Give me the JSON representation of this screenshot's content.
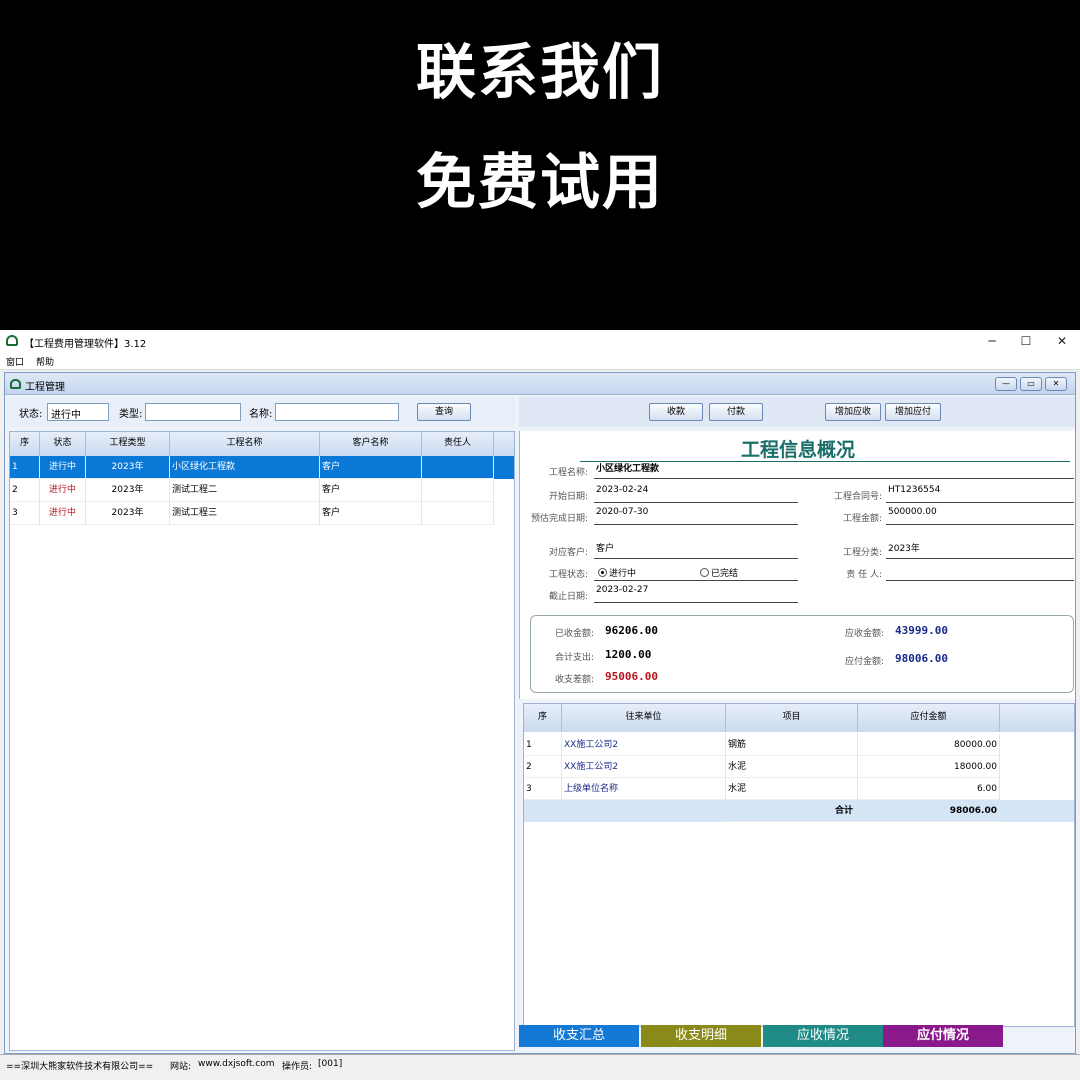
{
  "banner": {
    "line1": "联系我们",
    "line2": "免费试用"
  },
  "window": {
    "title": "【工程费用管理软件】3.12",
    "controls": {
      "minimize": "─",
      "maximize": "☐",
      "close": "✕"
    },
    "menu": [
      "窗口",
      "帮助"
    ]
  },
  "child": {
    "title": "工程管理",
    "controls": {
      "minimize": "—",
      "restore": "▭",
      "close": "✕"
    }
  },
  "filter": {
    "status_label": "状态:",
    "status_value": "进行中",
    "type_label": "类型:",
    "type_value": "",
    "name_label": "名称:",
    "name_value": "",
    "query_button": "查询"
  },
  "actions": {
    "receive": "收款",
    "pay": "付款",
    "add_receivable": "增加应收",
    "add_payable": "增加应付"
  },
  "project_table": {
    "columns": [
      "序",
      "状态",
      "工程类型",
      "工程名称",
      "客户名称",
      "责任人"
    ],
    "rows": [
      {
        "no": "1",
        "status": "进行中",
        "type": "2023年",
        "name": "小区绿化工程款",
        "client": "客户",
        "owner": ""
      },
      {
        "no": "2",
        "status": "进行中",
        "type": "2023年",
        "name": "测试工程二",
        "client": "客户",
        "owner": ""
      },
      {
        "no": "3",
        "status": "进行中",
        "type": "2023年",
        "name": "测试工程三",
        "client": "客户",
        "owner": ""
      }
    ]
  },
  "info": {
    "heading": "工程信息概况",
    "name_label": "工程名称:",
    "name": "小区绿化工程款",
    "start_label": "开始日期:",
    "start": "2023-02-24",
    "contract_label": "工程合同号:",
    "contract": "HT1236554",
    "expected_label": "预估完成日期:",
    "expected": "2020-07-30",
    "amount_label": "工程金额:",
    "amount": "500000.00",
    "client_label": "对应客户:",
    "client": "客户",
    "category_label": "工程分类:",
    "category": "2023年",
    "status_label": "工程状态:",
    "status_ongoing": "进行中",
    "status_done": "已完结",
    "owner_label": "责 任 人:",
    "owner": "",
    "deadline_label": "截止日期:",
    "deadline": "2023-02-27",
    "received_label": "已收金额:",
    "received": "96206.00",
    "receivable_label": "应收金额:",
    "receivable": "43999.00",
    "spent_label": "合计支出:",
    "spent": "1200.00",
    "payable_label": "应付金额:",
    "payable": "98006.00",
    "diff_label": "收支差额:",
    "diff": "95006.00"
  },
  "payable_table": {
    "columns": [
      "序",
      "往来单位",
      "项目",
      "应付金额"
    ],
    "rows": [
      {
        "no": "1",
        "unit": "XX施工公司2",
        "item": "钢筋",
        "amount": "80000.00"
      },
      {
        "no": "2",
        "unit": "XX施工公司2",
        "item": "水泥",
        "amount": "18000.00"
      },
      {
        "no": "3",
        "unit": "上级单位名称",
        "item": "水泥",
        "amount": "6.00"
      }
    ],
    "total_label": "合计",
    "total": "98006.00"
  },
  "tabs": [
    {
      "label": "收支汇总",
      "color": "#1479d4"
    },
    {
      "label": "收支明细",
      "color": "#8a8a1a"
    },
    {
      "label": "应收情况",
      "color": "#1f8a86"
    },
    {
      "label": "应付情况",
      "color": "#8a1a8c"
    }
  ],
  "status": {
    "company": "==深圳大熊家软件技术有限公司==",
    "website_label": "网站:",
    "website": "www.dxjsoft.com",
    "operator_label": "操作员:",
    "operator": "[001]"
  }
}
